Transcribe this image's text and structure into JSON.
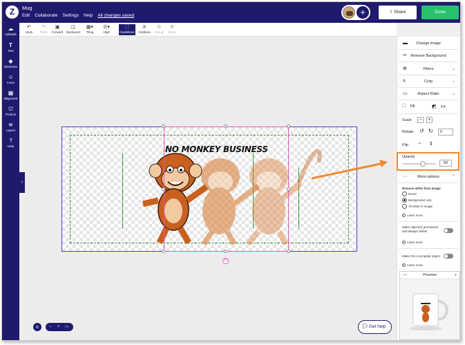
{
  "app": {
    "doc_title": "Mug",
    "menu": [
      "Edit",
      "Collaborate",
      "Settings",
      "Help"
    ],
    "save_status": "All changes saved",
    "share_label": "Share",
    "done_label": "Done",
    "brand_color": "#1f1a6e",
    "done_color": "#27c36b"
  },
  "leftnav": [
    {
      "label": "Uploads",
      "icon": "upload-cloud-icon"
    },
    {
      "label": "Text",
      "icon": "text-T-icon"
    },
    {
      "label": "Elements",
      "icon": "shapes-icon"
    },
    {
      "label": "Icons",
      "icon": "smiley-icon"
    },
    {
      "label": "Bkground",
      "icon": "background-icon"
    },
    {
      "label": "Product",
      "icon": "product-icon"
    },
    {
      "label": "Layers",
      "icon": "layers-icon"
    },
    {
      "label": "Help",
      "icon": "question-icon"
    }
  ],
  "toolbar": [
    {
      "label": "Undo",
      "icon": "undo-icon",
      "state": "normal"
    },
    {
      "label": "Redo",
      "icon": "redo-icon",
      "state": "disabled"
    },
    {
      "label": "Forward",
      "icon": "forward-icon",
      "state": "normal"
    },
    {
      "label": "Backward",
      "icon": "backward-icon",
      "state": "normal"
    },
    {
      "label": "Tiling",
      "icon": "tiling-icon",
      "state": "normal"
    },
    {
      "label": "Align",
      "icon": "align-icon",
      "state": "normal"
    },
    {
      "label": "Guidelines",
      "icon": "guidelines-icon",
      "state": "active"
    },
    {
      "label": "Gridlines",
      "icon": "gridlines-icon",
      "state": "normal"
    },
    {
      "label": "Group",
      "icon": "group-icon",
      "state": "disabled"
    },
    {
      "label": "Move",
      "icon": "move-icon",
      "state": "disabled"
    }
  ],
  "canvas": {
    "design_text": "NO MONKEY BUSINESS"
  },
  "zoom": {
    "minus": "−",
    "plus": "+",
    "fit": "Fit"
  },
  "help_button": "Get help",
  "panel": {
    "change_image": "Change image",
    "remove_background": "Remove Background",
    "filters": "Filters",
    "crop": "Crop",
    "aspect_ratio": "Aspect Ratio",
    "fill": "Fill",
    "fit": "Fit",
    "scale": "Scale",
    "rotate": "Rotate",
    "rotate_value": "0",
    "flip": "Flip",
    "opacity_label": "Opacity",
    "opacity_value": "60",
    "opacity_fraction": 0.6,
    "more_options": "More options",
    "remove_white_title": "Remove white from image",
    "radio_options": [
      "Never",
      "Background only",
      "All white in image"
    ],
    "radio_selected": "Background only",
    "learn_more": "Learn more",
    "permanent_label": "Make object(s) permanent and always visible",
    "template_label": "Make this a template object",
    "preview_title": "Preview",
    "highlight_color": "#ee8a2c"
  }
}
